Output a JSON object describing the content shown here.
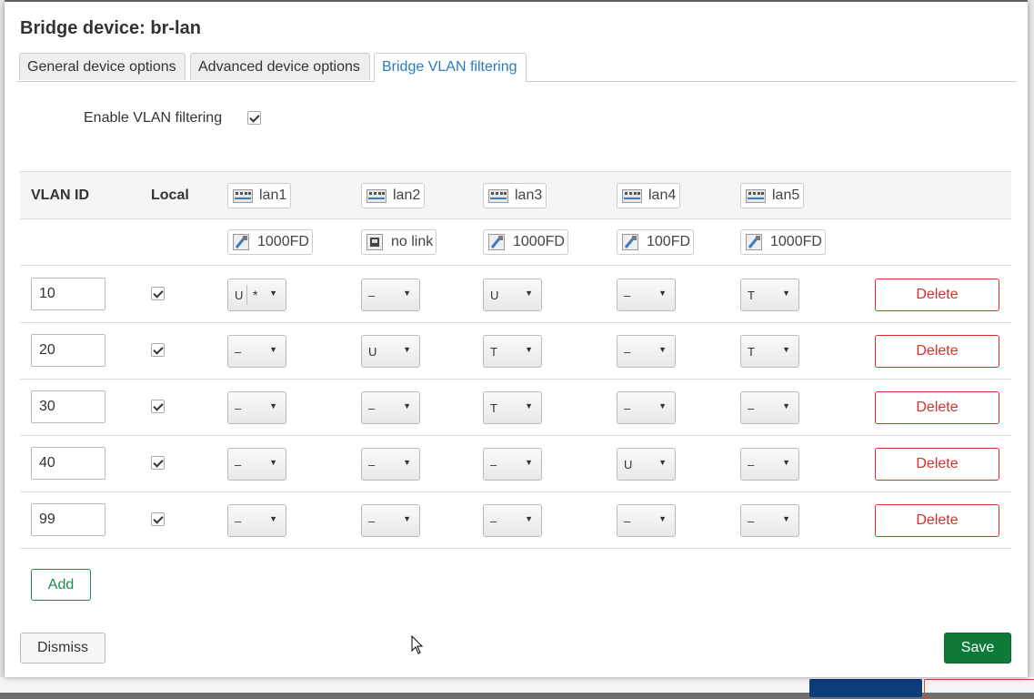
{
  "dialog": {
    "title": "Bridge device: br-lan"
  },
  "tabs": [
    {
      "label": "General device options",
      "active": false
    },
    {
      "label": "Advanced device options",
      "active": false
    },
    {
      "label": "Bridge VLAN filtering",
      "active": true
    }
  ],
  "vlan_filtering": {
    "label": "Enable VLAN filtering",
    "checked": true
  },
  "table": {
    "headers": {
      "vlan_id": "VLAN ID",
      "local": "Local"
    },
    "ports": [
      {
        "name": "lan1",
        "speed": "1000FD"
      },
      {
        "name": "lan2",
        "speed": "no link"
      },
      {
        "name": "lan3",
        "speed": "1000FD"
      },
      {
        "name": "lan4",
        "speed": "100FD"
      },
      {
        "name": "lan5",
        "speed": "1000FD"
      }
    ],
    "rows": [
      {
        "vlan_id": "10",
        "local": true,
        "ports": [
          "U",
          "–",
          "U",
          "–",
          "T"
        ],
        "primary": "*"
      },
      {
        "vlan_id": "20",
        "local": true,
        "ports": [
          "–",
          "U",
          "T",
          "–",
          "T"
        ]
      },
      {
        "vlan_id": "30",
        "local": true,
        "ports": [
          "–",
          "–",
          "T",
          "–",
          "–"
        ]
      },
      {
        "vlan_id": "40",
        "local": true,
        "ports": [
          "–",
          "–",
          "–",
          "U",
          "–"
        ]
      },
      {
        "vlan_id": "99",
        "local": true,
        "ports": [
          "–",
          "–",
          "–",
          "–",
          "–"
        ]
      }
    ],
    "delete_label": "Delete"
  },
  "buttons": {
    "add": "Add",
    "dismiss": "Dismiss",
    "save": "Save"
  },
  "colors": {
    "accent": "#2a7bc0",
    "delete": "#d9302b",
    "save": "#0f7a38",
    "add": "#1a8f4a"
  }
}
